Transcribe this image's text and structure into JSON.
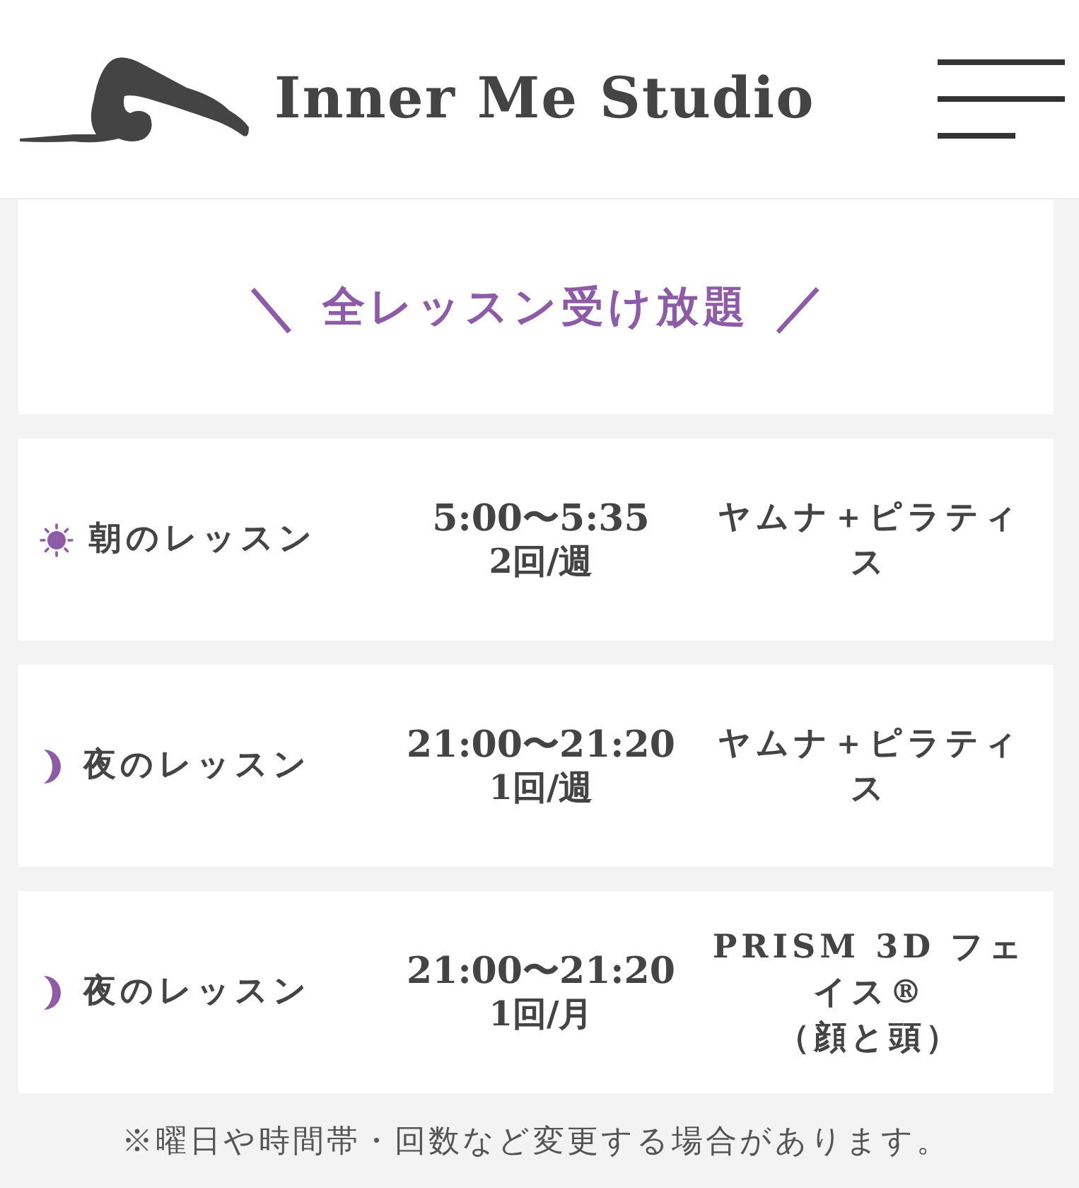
{
  "header": {
    "brand": "Inner Me Studio"
  },
  "banner": {
    "left_mark": "＼",
    "title": "全レッスン受け放題",
    "right_mark": "／"
  },
  "lessons": [
    {
      "kind": "sun",
      "name": "朝のレッスン",
      "time": "5:00〜5:35",
      "frequency": "2回/週",
      "program_lines": [
        "ヤムナ＋ピラティス"
      ]
    },
    {
      "kind": "moon",
      "name": "夜のレッスン",
      "time": "21:00〜21:20",
      "frequency": "1回/週",
      "program_lines": [
        "ヤムナ＋ピラティス"
      ]
    },
    {
      "kind": "moon",
      "name": "夜のレッスン",
      "time": "21:00〜21:20",
      "frequency": "1回/月",
      "program_lines": [
        "PRISM 3D フェイス®",
        "（顔と頭）"
      ]
    }
  ],
  "note": "※曜日や時間帯・回数など変更する場合があります。"
}
